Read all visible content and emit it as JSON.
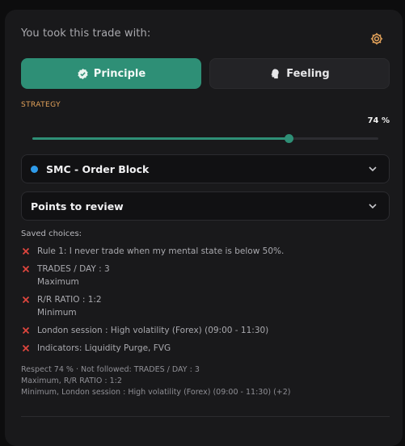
{
  "header": {
    "prompt": "You took this trade with:",
    "settings_icon": "gear-icon"
  },
  "mode_buttons": {
    "principle": {
      "label": "Principle",
      "icon": "check-badge-icon",
      "active": true
    },
    "feeling": {
      "label": "Feeling",
      "icon": "head-icon",
      "active": false
    }
  },
  "strategy": {
    "label": "STRATEGY",
    "percent_text": "74 %",
    "value": 0.74,
    "selected": "SMC - Order Block",
    "dot_color": "#2f9bea"
  },
  "review": {
    "label": "Points to review"
  },
  "saved": {
    "title": "Saved choices:",
    "items": [
      {
        "text": "Rule 1: I never trade when my mental state is below 50%."
      },
      {
        "text": "TRADES / DAY : 3",
        "sub": "Maximum"
      },
      {
        "text": "R/R RATIO : 1:2",
        "sub": "Minimum"
      },
      {
        "text": "London session : High volatility (Forex) (09:00 - 11:30)"
      },
      {
        "text": "Indicators: Liquidity Purge, FVG"
      }
    ]
  },
  "summary": {
    "line1": "Respect 74 % · Not followed: TRADES / DAY : 3",
    "line2": "Maximum, R/R RATIO : 1:2",
    "line3": "Minimum, London session : High volatility (Forex) (09:00 - 11:30) (+2)"
  },
  "colors": {
    "accent": "#2e8f76",
    "warning_label": "#e3a25a",
    "cross": "#e0463e"
  }
}
